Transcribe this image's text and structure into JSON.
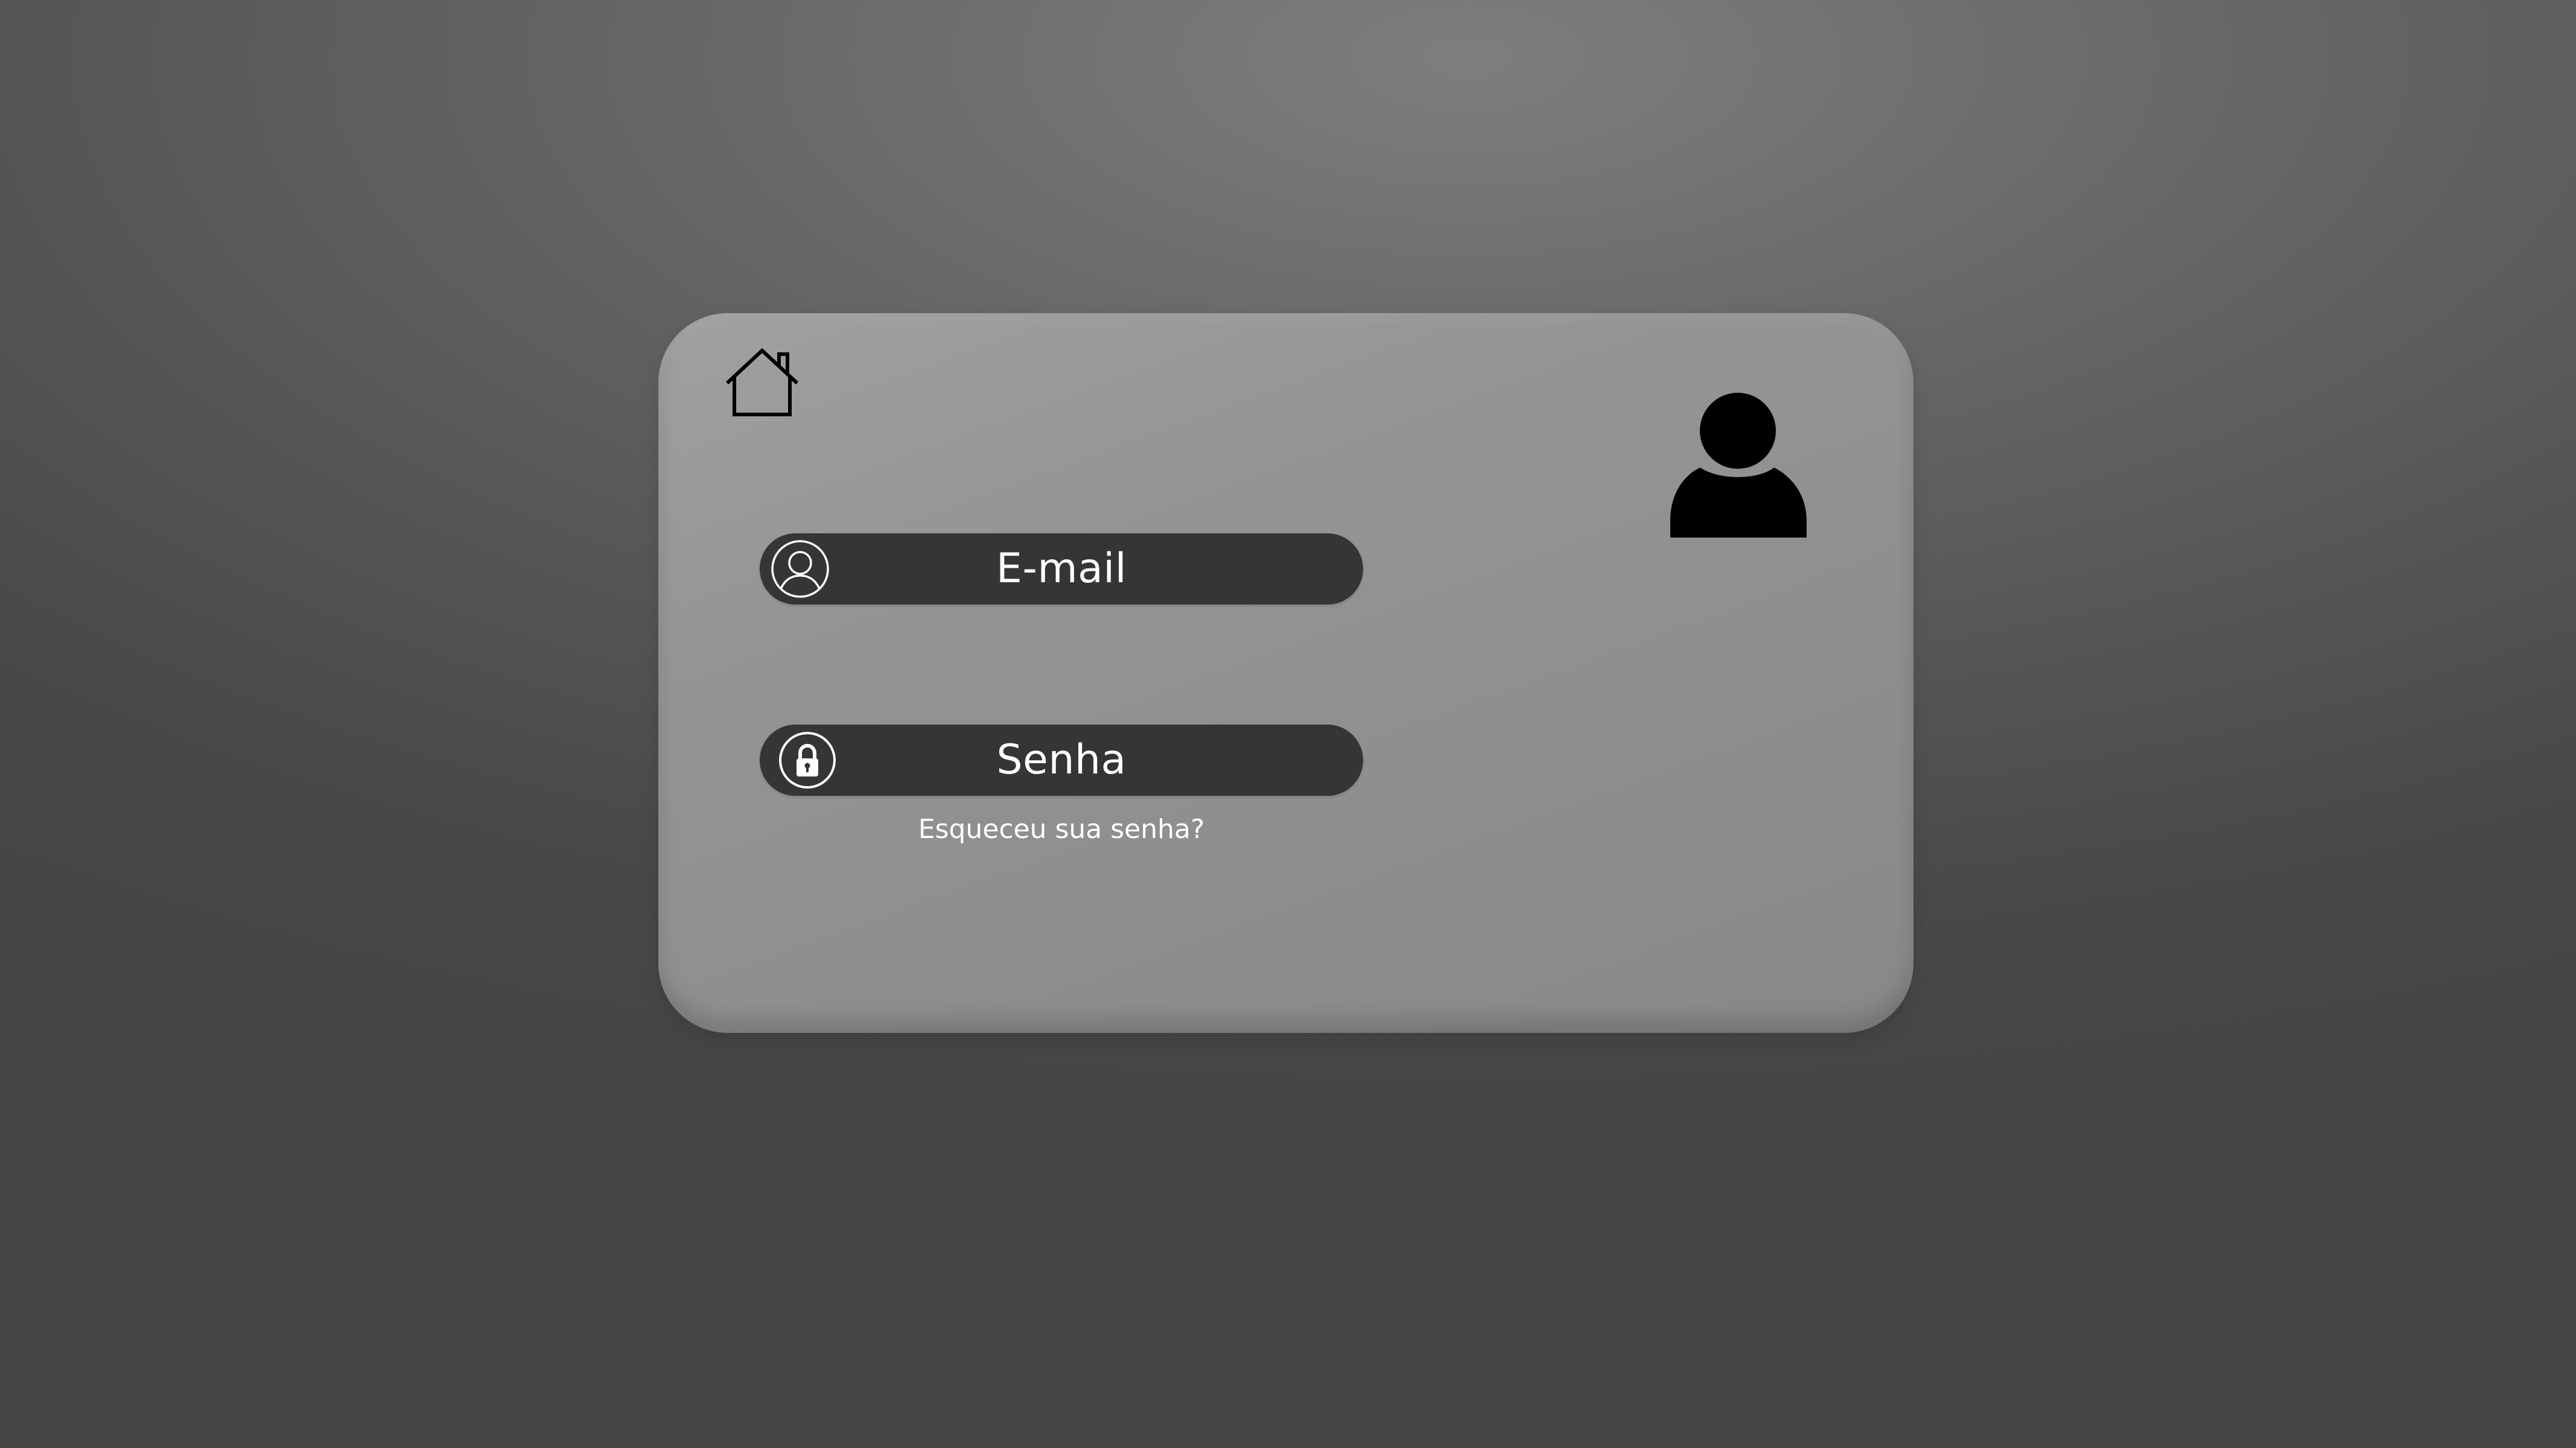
{
  "icons": {
    "home": "home-icon",
    "avatar": "user-avatar-icon",
    "email": "user-circle-icon",
    "password": "lock-circle-icon"
  },
  "form": {
    "email_placeholder": "E-mail",
    "password_placeholder": "Senha",
    "forgot_password": "Esqueceu sua senha?"
  },
  "colors": {
    "card": "#959595",
    "field_background": "#353535",
    "text": "#ffffff",
    "icon_dark": "#000000"
  }
}
